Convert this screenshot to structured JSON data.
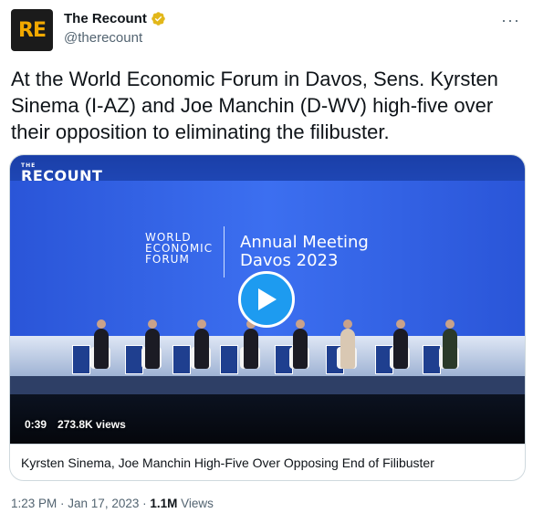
{
  "account": {
    "avatar_text": "RE",
    "name": "The Recount",
    "handle": "@therecount",
    "more_glyph": "···"
  },
  "tweet": {
    "text": "At the World Economic Forum in Davos, Sens. Kyrsten Sinema (I-AZ) and Joe Manchin (D-WV) high-five over their opposition to eliminating the filibuster."
  },
  "video": {
    "overlay_brand": "RECOUNT",
    "overlay_brand_small": "THE",
    "wef_line1": "WORLD",
    "wef_line2": "ECONOMIC",
    "wef_line3": "FORUM",
    "annual_line1": "Annual Meeting",
    "annual_line2": "Davos 2023",
    "duration": "0:39",
    "views": "273.8K views",
    "title": "Kyrsten Sinema, Joe Manchin High-Five Over Opposing End of Filibuster"
  },
  "meta": {
    "time": "1:23 PM",
    "sep1": " · ",
    "date": "Jan 17, 2023",
    "sep2": " · ",
    "views_count": "1.1M",
    "views_label": " Views"
  },
  "colors": {
    "accent": "#1d9bf0",
    "verified": "#e2b719",
    "avatar_text": "#f2a900"
  }
}
